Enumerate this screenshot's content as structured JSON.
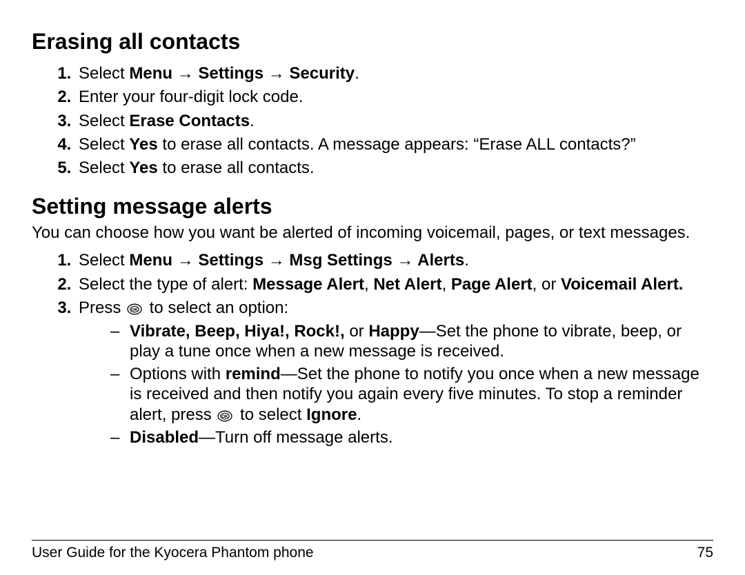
{
  "section1": {
    "heading": "Erasing all contacts",
    "steps": {
      "s1_pre": "Select ",
      "s1_bold": "Menu → Settings → Security",
      "s1_post": ".",
      "s2": "Enter your four-digit lock code.",
      "s3_pre": "Select ",
      "s3_bold": "Erase Contacts",
      "s3_post": ".",
      "s4_pre": "Select ",
      "s4_bold": "Yes",
      "s4_post": " to erase all contacts. A message appears: “Erase ALL contacts?”",
      "s5_pre": "Select ",
      "s5_bold": "Yes",
      "s5_post": " to erase all contacts."
    }
  },
  "section2": {
    "heading": "Setting message alerts",
    "intro": "You can choose how you want be alerted of incoming voicemail, pages, or text messages.",
    "steps": {
      "s1_pre": "Select ",
      "s1_bold": "Menu → Settings → Msg Settings → Alerts",
      "s1_post": ".",
      "s2_pre": "Select the type of alert: ",
      "s2_b1": "Message Alert",
      "s2_c1": ", ",
      "s2_b2": "Net Alert",
      "s2_c2": ", ",
      "s2_b3": "Page Alert",
      "s2_c3": ", or ",
      "s2_b4": "Voicemail Alert.",
      "s3_pre": "Press ",
      "s3_post": " to select an option:",
      "sub": {
        "a_b1": "Vibrate, Beep, Hiya!, Rock!, ",
        "a_mid1": "or ",
        "a_b2": "Happy",
        "a_post": "—Set the phone to vibrate, beep, or play a tune once when a new message is received.",
        "b_pre": "Options with ",
        "b_b1": "remind",
        "b_mid": "—Set the phone to notify you once when a new message is received and then notify you again every five minutes. To stop a reminder alert, press ",
        "b_mid2": " to select ",
        "b_b2": "Ignore",
        "b_post": ".",
        "c_b1": "Disabled",
        "c_post": "—Turn off message alerts."
      }
    }
  },
  "footer": {
    "left": "User Guide for the Kyocera Phantom phone",
    "right": "75"
  },
  "icons": {
    "ok": "ok-button-icon"
  }
}
